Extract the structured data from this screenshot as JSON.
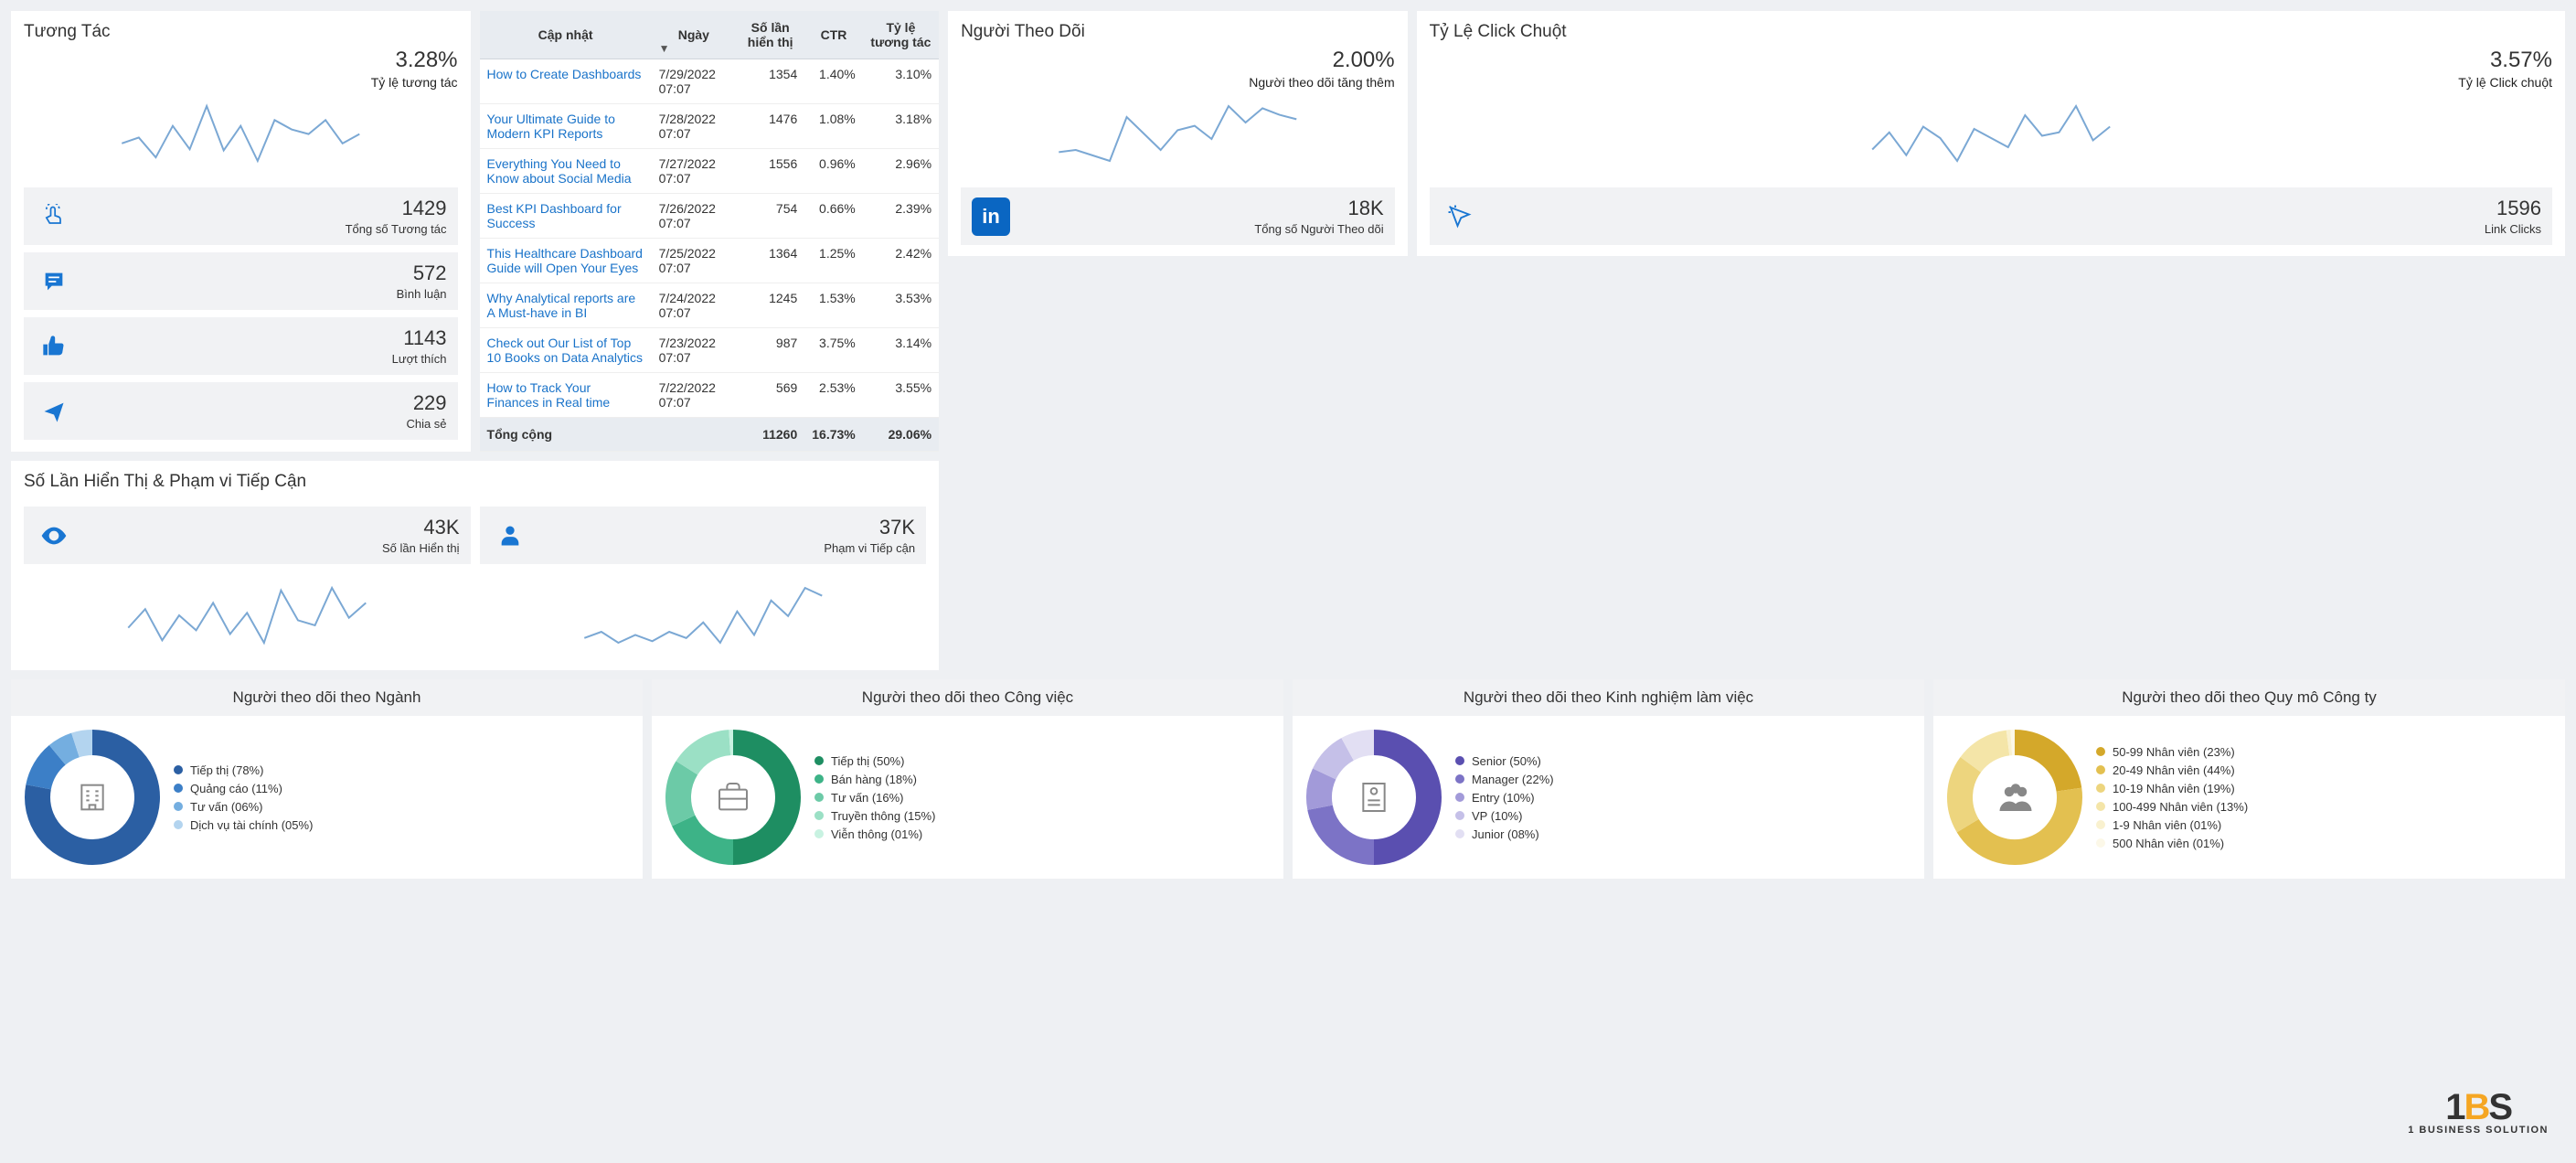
{
  "followers": {
    "title": "Người Theo Dõi",
    "pct": "2.00%",
    "pct_label": "Người theo dõi tăng thêm",
    "metric_val": "18K",
    "metric_lbl": "Tổng số Người Theo dõi"
  },
  "ctr": {
    "title": "Tỷ Lệ Click Chuột",
    "pct": "3.57%",
    "pct_label": "Tỷ lệ Click chuột",
    "metric_val": "1596",
    "metric_lbl": "Link Clicks"
  },
  "engagement": {
    "title": "Tương Tác",
    "pct": "3.28%",
    "pct_label": "Tỷ lệ tương tác",
    "metrics": [
      {
        "val": "1429",
        "lbl": "Tổng số Tương tác",
        "icon": "tap"
      },
      {
        "val": "572",
        "lbl": "Bình luận",
        "icon": "comment"
      },
      {
        "val": "1143",
        "lbl": "Lượt thích",
        "icon": "like"
      },
      {
        "val": "229",
        "lbl": "Chia sẻ",
        "icon": "share"
      }
    ]
  },
  "reach": {
    "title": "Số Lần Hiển Thị & Phạm vi Tiếp Cận",
    "m1_val": "43K",
    "m1_lbl": "Số lần Hiển thị",
    "m2_val": "37K",
    "m2_lbl": "Phạm vi Tiếp cận"
  },
  "table": {
    "headers": [
      "Cập nhật",
      "Ngày",
      "Số lần hiển thị",
      "CTR",
      "Tỷ lệ tương tác"
    ],
    "rows": [
      {
        "title": "How to Create Dashboards",
        "date": "7/29/2022 07:07",
        "impr": "1354",
        "ctr": "1.40%",
        "eng": "3.10%"
      },
      {
        "title": "Your Ultimate Guide to Modern KPI Reports",
        "date": "7/28/2022 07:07",
        "impr": "1476",
        "ctr": "1.08%",
        "eng": "3.18%"
      },
      {
        "title": "Everything You Need to Know about Social Media",
        "date": "7/27/2022 07:07",
        "impr": "1556",
        "ctr": "0.96%",
        "eng": "2.96%"
      },
      {
        "title": "Best KPI Dashboard for Success",
        "date": "7/26/2022 07:07",
        "impr": "754",
        "ctr": "0.66%",
        "eng": "2.39%"
      },
      {
        "title": "This Healthcare Dashboard Guide will Open Your Eyes",
        "date": "7/25/2022 07:07",
        "impr": "1364",
        "ctr": "1.25%",
        "eng": "2.42%"
      },
      {
        "title": "Why Analytical reports are A Must-have in BI",
        "date": "7/24/2022 07:07",
        "impr": "1245",
        "ctr": "1.53%",
        "eng": "3.53%"
      },
      {
        "title": "Check out Our List of Top 10 Books on Data Analytics",
        "date": "7/23/2022 07:07",
        "impr": "987",
        "ctr": "3.75%",
        "eng": "3.14%"
      },
      {
        "title": "How to Track Your Finances in Real time",
        "date": "7/22/2022 07:07",
        "impr": "569",
        "ctr": "2.53%",
        "eng": "3.55%"
      }
    ],
    "total_lbl": "Tổng cộng",
    "total_impr": "11260",
    "total_ctr": "16.73%",
    "total_eng": "29.06%"
  },
  "donuts": [
    {
      "title": "Người theo dõi theo Ngành",
      "colors": [
        "#2b5fa3",
        "#3c7fc7",
        "#74aee0",
        "#b3d4ef"
      ],
      "legend": [
        "Tiếp thị (78%)",
        "Quảng cáo (11%)",
        "Tư vấn (06%)",
        "Dịch vụ tài chính (05%)"
      ],
      "values": [
        78,
        11,
        6,
        5
      ],
      "icon": "building"
    },
    {
      "title": "Người theo dõi theo Công việc",
      "colors": [
        "#1e8e62",
        "#3db387",
        "#6ccaa7",
        "#9be0c5",
        "#c8f2e1"
      ],
      "legend": [
        "Tiếp thị (50%)",
        "Bán hàng (18%)",
        "Tư vấn (16%)",
        "Truyền thông (15%)",
        "Viễn thông (01%)"
      ],
      "values": [
        50,
        18,
        16,
        15,
        1
      ],
      "icon": "briefcase"
    },
    {
      "title": "Người theo dõi theo Kinh nghiệm làm việc",
      "colors": [
        "#5a4fb0",
        "#7c73c6",
        "#a29ad9",
        "#c5c0e8",
        "#e2dff3"
      ],
      "legend": [
        "Senior (50%)",
        "Manager (22%)",
        "Entry (10%)",
        "VP (10%)",
        "Junior (08%)"
      ],
      "values": [
        50,
        22,
        10,
        10,
        8
      ],
      "icon": "resume"
    },
    {
      "title": "Người theo dõi theo Quy mô Công ty",
      "colors": [
        "#d4a82a",
        "#e3c050",
        "#edd57e",
        "#f4e5a8",
        "#f9f1cf",
        "#fcf8e8"
      ],
      "legend": [
        "50-99 Nhân viên (23%)",
        "20-49 Nhân viên (44%)",
        "10-19 Nhân viên (19%)",
        "100-499 Nhân viên (13%)",
        "1-9 Nhân viên (01%)",
        "500 Nhân viên (01%)"
      ],
      "values": [
        23,
        44,
        19,
        13,
        1,
        1
      ],
      "icon": "people"
    }
  ],
  "chart_data": {
    "sparklines": [
      {
        "name": "followers",
        "type": "line",
        "values": [
          28,
          30,
          25,
          20,
          60,
          45,
          30,
          48,
          52,
          40,
          70,
          55,
          68,
          62,
          58
        ]
      },
      {
        "name": "ctr",
        "type": "line",
        "values": [
          40,
          55,
          35,
          60,
          50,
          30,
          58,
          50,
          42,
          70,
          52,
          55,
          78,
          48,
          60
        ]
      },
      {
        "name": "engagement",
        "type": "line",
        "values": [
          40,
          45,
          28,
          55,
          35,
          72,
          34,
          55,
          25,
          60,
          52,
          48,
          60,
          40,
          48
        ]
      },
      {
        "name": "impressions",
        "type": "line",
        "values": [
          40,
          55,
          30,
          50,
          38,
          60,
          35,
          52,
          28,
          70,
          46,
          42,
          72,
          48,
          60
        ]
      },
      {
        "name": "reach",
        "type": "line",
        "values": [
          38,
          42,
          35,
          40,
          36,
          42,
          38,
          48,
          35,
          55,
          40,
          62,
          52,
          70,
          65
        ]
      }
    ],
    "donuts": [
      {
        "name": "industry",
        "type": "pie",
        "categories": [
          "Tiếp thị",
          "Quảng cáo",
          "Tư vấn",
          "Dịch vụ tài chính"
        ],
        "values": [
          78,
          11,
          6,
          5
        ]
      },
      {
        "name": "job",
        "type": "pie",
        "categories": [
          "Tiếp thị",
          "Bán hàng",
          "Tư vấn",
          "Truyền thông",
          "Viễn thông"
        ],
        "values": [
          50,
          18,
          16,
          15,
          1
        ]
      },
      {
        "name": "experience",
        "type": "pie",
        "categories": [
          "Senior",
          "Manager",
          "Entry",
          "VP",
          "Junior"
        ],
        "values": [
          50,
          22,
          10,
          10,
          8
        ]
      },
      {
        "name": "company_size",
        "type": "pie",
        "categories": [
          "50-99",
          "20-49",
          "10-19",
          "100-499",
          "1-9",
          "500"
        ],
        "values": [
          23,
          44,
          19,
          13,
          1,
          1
        ]
      }
    ],
    "kpis": {
      "followers_growth_pct": 2.0,
      "total_followers": 18000,
      "ctr_pct": 3.57,
      "link_clicks": 1596,
      "engagement_pct": 3.28,
      "total_engagement": 1429,
      "comments": 572,
      "likes": 1143,
      "shares": 229,
      "impressions": 43000,
      "reach": 37000
    }
  },
  "logo": {
    "text1": "1",
    "textB": "B",
    "textS": "S",
    "sub": "1 BUSINESS SOLUTION"
  }
}
